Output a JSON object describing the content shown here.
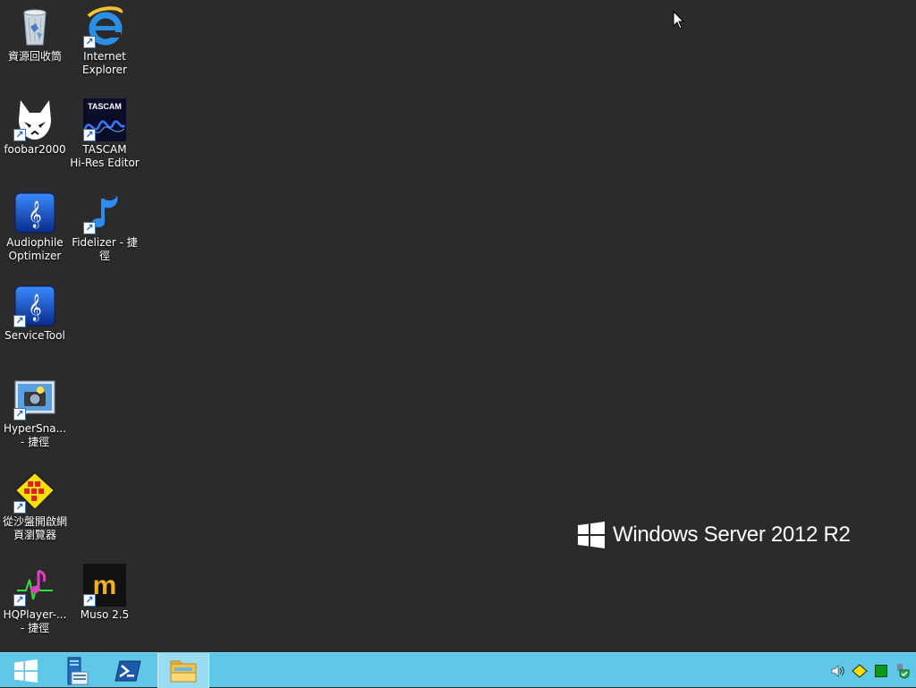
{
  "desktop": {
    "icons": [
      {
        "label": "資源回收筒",
        "icon": "recycle-bin-icon"
      },
      {
        "label": "Internet\nExplorer",
        "icon": "internet-explorer-icon"
      },
      {
        "label": "foobar2000",
        "icon": "foobar2000-icon"
      },
      {
        "label": "TASCAM\nHi-Res Editor",
        "icon": "tascam-icon"
      },
      {
        "label": "Audiophile\nOptimizer",
        "icon": "audiophile-optimizer-icon"
      },
      {
        "label": "Fidelizer - 捷\n徑",
        "icon": "fidelizer-icon"
      },
      {
        "label": "ServiceTool",
        "icon": "servicetool-icon"
      },
      {
        "label": "HyperSna...\n- 捷徑",
        "icon": "hypersnap-icon"
      },
      {
        "label": "從沙盤開啟網\n頁瀏覽器",
        "icon": "sandboxie-icon"
      },
      {
        "label": "HQPlayer-...\n- 捷徑",
        "icon": "hqplayer-icon"
      },
      {
        "label": "Muso 2.5",
        "icon": "muso-icon"
      }
    ],
    "tascam_text": "TASCAM"
  },
  "branding": {
    "text": "Windows Server 2012 R2"
  },
  "taskbar": {
    "buttons": [
      {
        "name": "start",
        "icon": "windows-start-icon"
      },
      {
        "name": "server-manager",
        "icon": "server-manager-icon"
      },
      {
        "name": "powershell",
        "icon": "powershell-icon"
      },
      {
        "name": "file-explorer",
        "icon": "file-explorer-icon",
        "active": true
      }
    ],
    "tray": [
      "speaker-icon",
      "network-warning-icon",
      "green-square-icon",
      "security-shield-icon"
    ]
  },
  "colors": {
    "desktop": "#2b2b2b",
    "taskbar": "#5fc8e8",
    "accent_blue": "#1e7fd8"
  }
}
